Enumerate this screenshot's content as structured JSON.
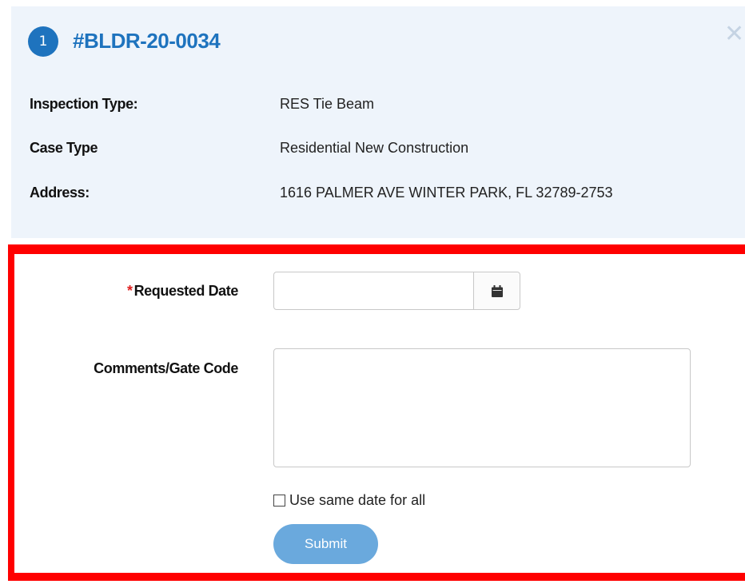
{
  "header": {
    "step_number": "1",
    "case_number": "#BLDR-20-0034",
    "close_icon": "close-icon"
  },
  "details": [
    {
      "label": "Inspection Type:",
      "value": "RES Tie Beam"
    },
    {
      "label": "Case Type",
      "value": "Residential New Construction"
    },
    {
      "label": "Address:",
      "value": "1616 PALMER AVE WINTER PARK, FL 32789-2753"
    }
  ],
  "form": {
    "requested_date_label": "Requested Date",
    "required_marker": "*",
    "requested_date_value": "",
    "calendar_icon": "calendar-icon",
    "comments_label": "Comments/Gate Code",
    "comments_value": "",
    "same_date_label": "Use same date for all",
    "same_date_checked": false,
    "submit_label": "Submit"
  },
  "colors": {
    "accent_blue": "#1e73be",
    "submit_blue": "#6aa9dd",
    "highlight_red": "#ff0000",
    "panel_background": "#eef4fb",
    "required_red": "#e02020"
  }
}
